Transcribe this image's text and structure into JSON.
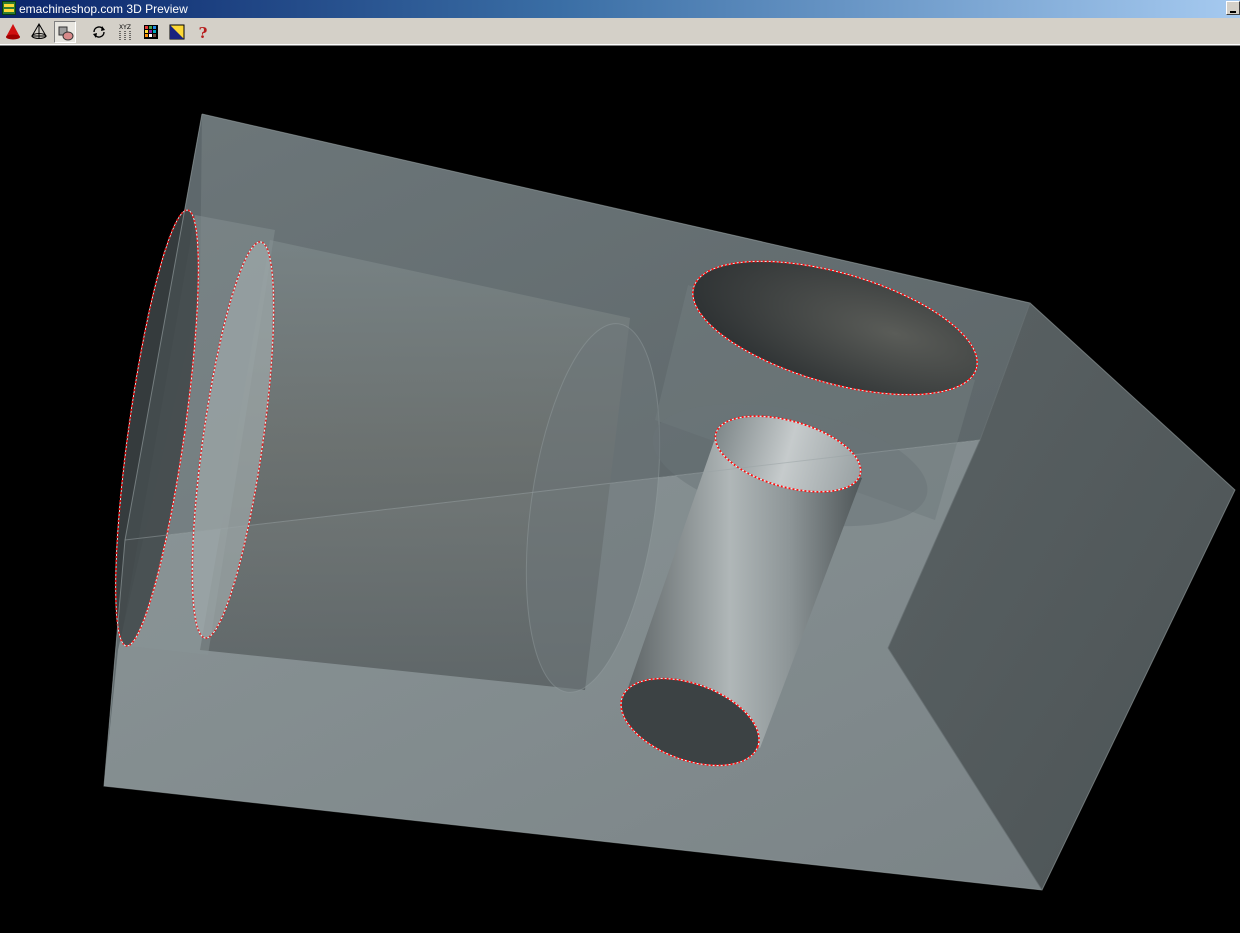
{
  "window": {
    "title": "emachineshop.com 3D Preview"
  },
  "toolbar": {
    "buttons": [
      {
        "name": "solid-view-button",
        "icon": "solid-cone-icon",
        "pressed": false
      },
      {
        "name": "wireframe-view-button",
        "icon": "wire-cone-icon",
        "pressed": false
      },
      {
        "name": "transparent-view-button",
        "icon": "transparent-shapes-icon",
        "pressed": true
      },
      {
        "name": "rotate-button",
        "icon": "rotate-icon",
        "pressed": false
      },
      {
        "name": "axes-button",
        "icon": "xyz-axes-icon",
        "pressed": false
      },
      {
        "name": "color-button",
        "icon": "color-grid-icon",
        "pressed": false
      },
      {
        "name": "background-color-button",
        "icon": "background-color-icon",
        "pressed": false
      },
      {
        "name": "help-button",
        "icon": "help-icon",
        "pressed": false
      }
    ],
    "axes_label": "XYZ"
  },
  "colors": {
    "titlebar_start": "#0a246a",
    "titlebar_end": "#a6caf0",
    "toolbar_bg": "#d4d0c8",
    "viewport_bg": "#000000",
    "hole_edge": "#ff1010",
    "part_face": "#7a8587"
  },
  "viewport": {
    "render_mode": "transparent",
    "selected_edges": "dotted red"
  }
}
